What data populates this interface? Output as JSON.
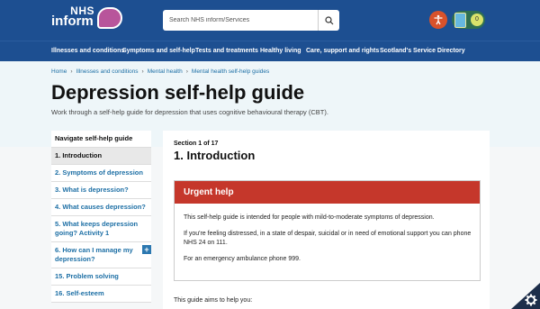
{
  "header": {
    "logo_nhs": "NHS",
    "logo_inform": "inform",
    "search_placeholder": "Search NHS inform/Services",
    "notifications_count": "0"
  },
  "nav": {
    "items": [
      "Illnesses and conditions",
      "Symptoms and self-help",
      "Tests and treatments",
      "Healthy living",
      "Care, support and rights",
      "Scotland's Service Directory"
    ]
  },
  "breadcrumb": [
    "Home",
    "Illnesses and conditions",
    "Mental health",
    "Mental health self-help guides"
  ],
  "page": {
    "title": "Depression self-help guide",
    "subtitle": "Work through a self-help guide for depression that uses cognitive behavioural therapy (CBT)."
  },
  "sidebar": {
    "heading": "Navigate self-help guide",
    "items": [
      {
        "label": "1. Introduction"
      },
      {
        "label": "2. Symptoms of depression"
      },
      {
        "label": "3. What is depression?"
      },
      {
        "label": "4. What causes depression?"
      },
      {
        "label": "5. What keeps depression going? Activity 1"
      },
      {
        "label": "6. How can I manage my depression?"
      },
      {
        "label": "15. Problem solving"
      },
      {
        "label": "16. Self-esteem"
      }
    ]
  },
  "main": {
    "section_count": "Section 1 of 17",
    "section_title": "1. Introduction",
    "urgent_title": "Urgent help",
    "urgent_p1": "This self-help guide is intended for people with mild-to-moderate symptoms of depression.",
    "urgent_p2": "If you're feeling distressed, in a state of despair, suicidal or in need of emotional support you can phone NHS 24 on 111.",
    "urgent_p3": "For an emergency ambulance phone 999.",
    "aims_text": "This guide aims to help you:"
  },
  "colors": {
    "header_blue": "#1d4f91",
    "urgent_red": "#c5372b",
    "link_blue": "#1d6fa5"
  }
}
